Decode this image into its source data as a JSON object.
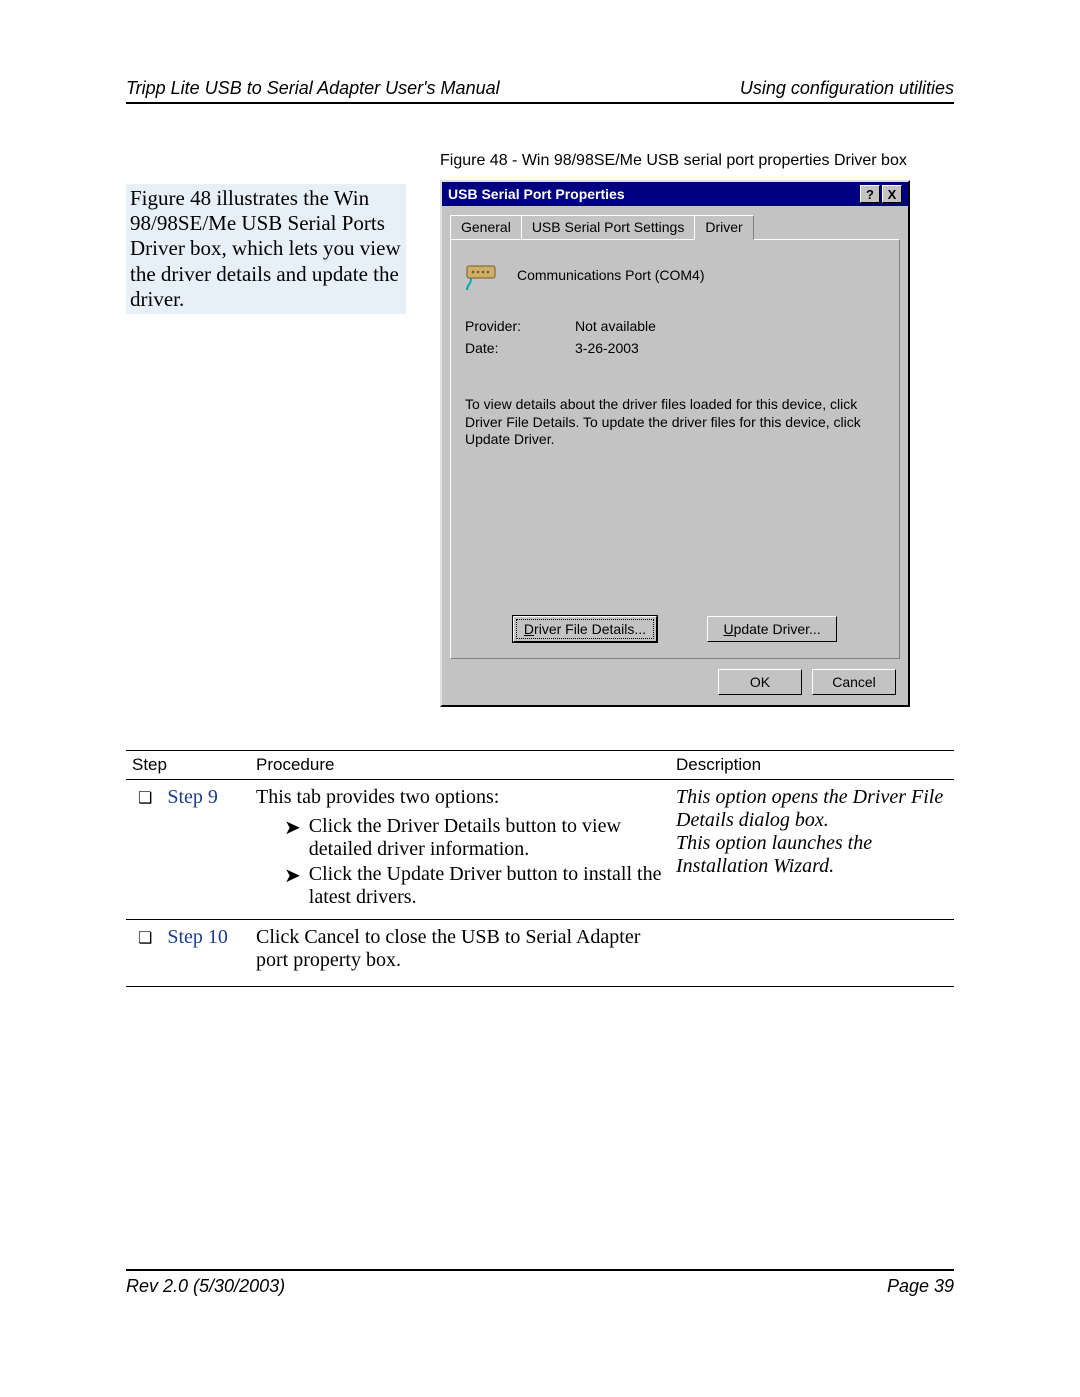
{
  "header": {
    "left": "Tripp Lite USB to Serial Adapter User's Manual",
    "right": "Using configuration utilities"
  },
  "footer": {
    "left": "Rev 2.0 (5/30/2003)",
    "right": "Page 39"
  },
  "figure_caption": "Figure 48 - Win 98/98SE/Me USB serial port properties Driver box",
  "intro_text": "Figure 48 illustrates the Win 98/98SE/Me USB Serial Ports Driver box, which lets you view the driver details and update the driver.",
  "dialog": {
    "title": "USB Serial Port Properties",
    "help_btn": "?",
    "close_btn": "X",
    "tabs": {
      "general": "General",
      "settings": "USB Serial Port Settings",
      "driver": "Driver"
    },
    "device_name": "Communications Port (COM4)",
    "provider_label": "Provider:",
    "provider_value": "Not available",
    "date_label": "Date:",
    "date_value": "3-26-2003",
    "instructions": "To view details about the driver files loaded for this device, click Driver File Details.  To update the driver files for this device, click Update Driver.",
    "btn_details": "Driver File Details...",
    "btn_update": "Update Driver...",
    "btn_ok": "OK",
    "btn_cancel": "Cancel"
  },
  "table": {
    "head_step": "Step",
    "head_proc": "Procedure",
    "head_desc": "Description",
    "rows": [
      {
        "step": "Step 9",
        "proc_main": "This tab provides two options:",
        "bullets": [
          "Click the Driver Details button to view detailed driver information.",
          "Click the Update Driver button to install the latest drivers."
        ],
        "desc": [
          "This option opens the Driver File Details dialog box.",
          "This option launches the Installation Wizard."
        ]
      },
      {
        "step": "Step 10",
        "proc_main": "Click Cancel to close the USB to Serial Adapter port property box.",
        "bullets": [],
        "desc": []
      }
    ]
  }
}
